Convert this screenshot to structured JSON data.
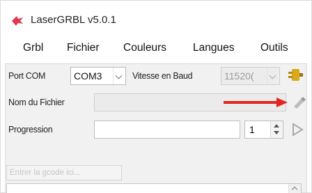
{
  "window": {
    "title": "LaserGRBL v5.0.1"
  },
  "menu": {
    "items": [
      "Grbl",
      "Fichier",
      "Couleurs",
      "Langues",
      "Outils"
    ]
  },
  "connection": {
    "port_label": "Port COM",
    "port_value": "COM3",
    "baud_label": "Vitesse en Baud",
    "baud_value": "11520("
  },
  "file": {
    "label": "Nom du Fichier",
    "value": ""
  },
  "progress": {
    "label": "Progression",
    "passes": "1"
  },
  "grbl_command": {
    "placeholder": "Entrer la gcode ici..."
  },
  "colors": {
    "accent_red": "#e0261f",
    "icon_gold": "#d9a91c"
  }
}
